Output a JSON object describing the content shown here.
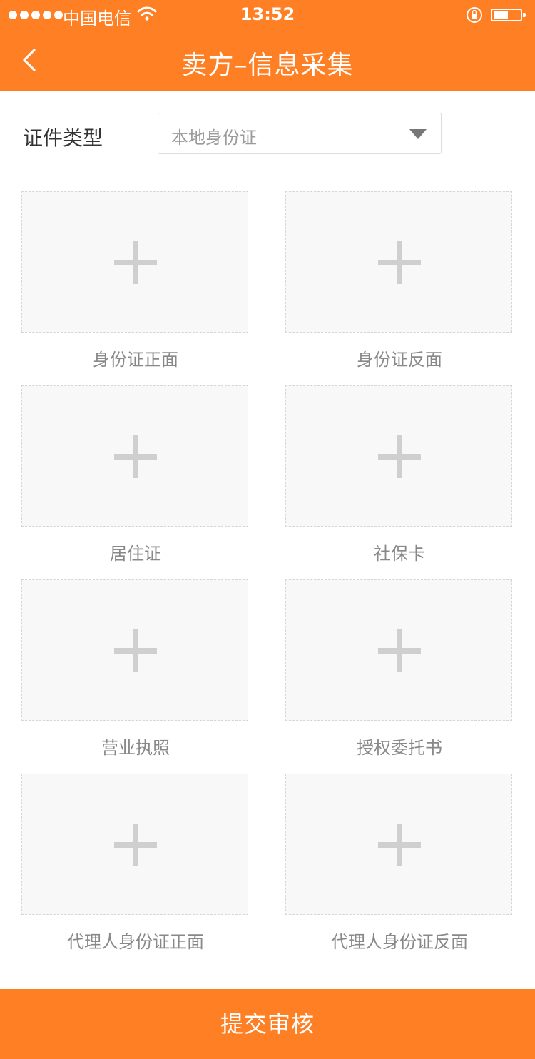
{
  "status_bar": {
    "carrier": "中国电信",
    "time": "13:52"
  },
  "nav": {
    "title": "卖方–信息采集"
  },
  "cert": {
    "label": "证件类型",
    "selected": "本地身份证"
  },
  "uploads": [
    {
      "label": "身份证正面"
    },
    {
      "label": "身份证反面"
    },
    {
      "label": "居住证"
    },
    {
      "label": "社保卡"
    },
    {
      "label": "营业执照"
    },
    {
      "label": "授权委托书"
    },
    {
      "label": "代理人身份证正面"
    },
    {
      "label": "代理人身份证反面"
    }
  ],
  "submit": {
    "label": "提交审核"
  },
  "colors": {
    "accent": "#ff7f24",
    "plus": "#cfcfcf",
    "tile_bg": "#f8f8f8"
  },
  "icons": {
    "back": "chevron-left-icon",
    "dropdown": "caret-down-icon",
    "add": "plus-icon"
  }
}
